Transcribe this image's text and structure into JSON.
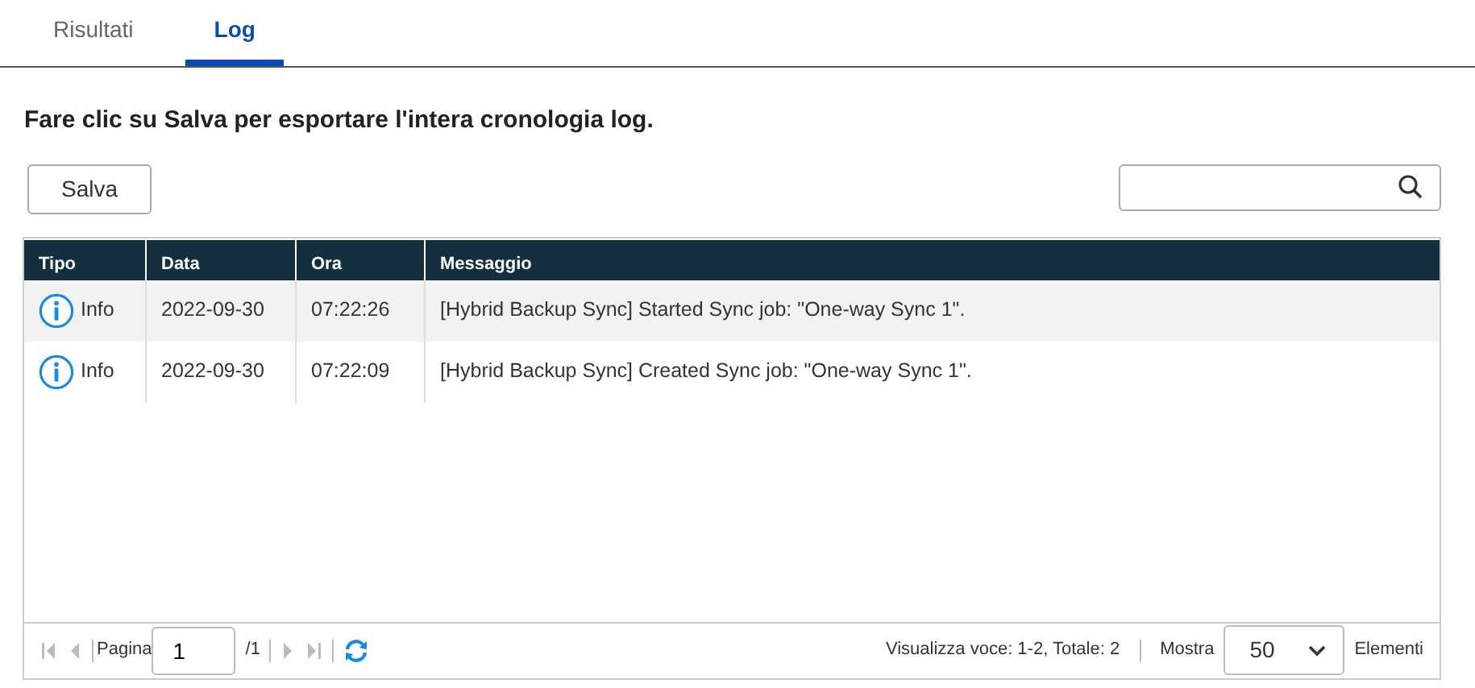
{
  "tabs": [
    {
      "label": "Risultati",
      "selected": false
    },
    {
      "label": "Log",
      "selected": true
    }
  ],
  "instruction": "Fare clic su Salva per esportare l'intera cronologia log.",
  "save_button": "Salva",
  "table": {
    "columns": [
      "Tipo",
      "Data",
      "Ora",
      "Messaggio"
    ],
    "rows": [
      {
        "kind": "info",
        "type": "Info",
        "date": "2022-09-30",
        "time": "07:22:26",
        "message": "[Hybrid Backup Sync] Started Sync job: \"One-way Sync 1\".",
        "selected": true
      },
      {
        "kind": "info",
        "type": "Info",
        "date": "2022-09-30",
        "time": "07:22:09",
        "message": "[Hybrid Backup Sync] Created Sync job: \"One-way Sync 1\".",
        "selected": false
      }
    ]
  },
  "pager": {
    "page_label": "Pagina",
    "page": "1",
    "page_total": "/1",
    "summary": "Visualizza voce: 1-2, Totale: 2",
    "show_label": "Mostra",
    "page_size": "50",
    "items_label": "Elementi"
  }
}
